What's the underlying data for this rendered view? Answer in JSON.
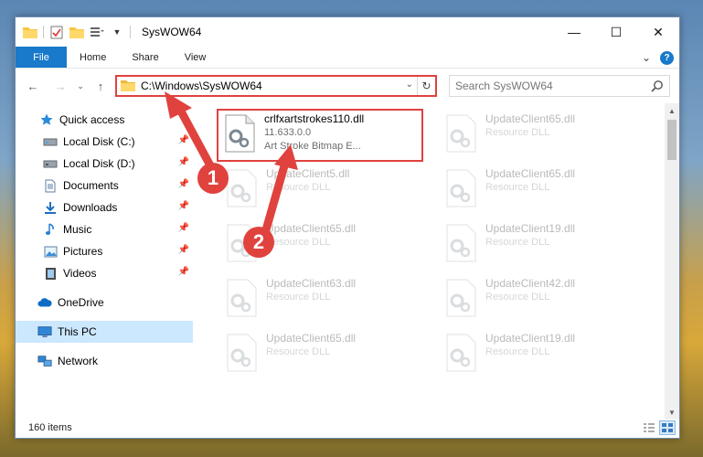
{
  "window": {
    "title": "SysWOW64",
    "controls": {
      "minimize": "—",
      "maximize": "☐",
      "close": "✕"
    }
  },
  "ribbon": {
    "tabs": [
      "File",
      "Home",
      "Share",
      "View"
    ],
    "help": "?",
    "expand": "⌄"
  },
  "nav": {
    "back": "←",
    "forward": "→",
    "recent": "⌄",
    "up": "↑",
    "address": "C:\\Windows\\SysWOW64",
    "dropdown": "⌄",
    "refresh": "↻",
    "search_placeholder": "Search SysWOW64"
  },
  "sidebar": {
    "items": [
      {
        "label": "Quick access",
        "icon": "star-icon",
        "pinned": false
      },
      {
        "label": "Local Disk (C:)",
        "icon": "drive-icon",
        "pinned": true
      },
      {
        "label": "Local Disk (D:)",
        "icon": "drive-icon",
        "pinned": true
      },
      {
        "label": "Documents",
        "icon": "document-icon",
        "pinned": true
      },
      {
        "label": "Downloads",
        "icon": "download-icon",
        "pinned": true
      },
      {
        "label": "Music",
        "icon": "music-icon",
        "pinned": true
      },
      {
        "label": "Pictures",
        "icon": "pictures-icon",
        "pinned": true
      },
      {
        "label": "Videos",
        "icon": "videos-icon",
        "pinned": true
      },
      {
        "label": "OneDrive",
        "icon": "cloud-icon",
        "pinned": false
      },
      {
        "label": "This PC",
        "icon": "computer-icon",
        "pinned": false,
        "selected": true
      },
      {
        "label": "Network",
        "icon": "network-icon",
        "pinned": false
      }
    ]
  },
  "files": [
    {
      "name": "crlfxartstrokes110.dll",
      "line2": "11.633.0.0",
      "line3": "Art Stroke Bitmap E...",
      "highlighted": true
    },
    {
      "name": "UpdateClient65.dll",
      "line2": "Resource DLL",
      "highlighted": false
    },
    {
      "name": "UpdateClient5.dll",
      "line2": "Resource DLL",
      "highlighted": false
    },
    {
      "name": "UpdateClient65.dll",
      "line2": "Resource DLL",
      "highlighted": false
    },
    {
      "name": "UpdateClient65.dll",
      "line2": "Resource DLL",
      "highlighted": false
    },
    {
      "name": "UpdateClient19.dll",
      "line2": "Resource DLL",
      "highlighted": false
    },
    {
      "name": "UpdateClient63.dll",
      "line2": "Resource DLL",
      "highlighted": false
    },
    {
      "name": "UpdateClient42.dll",
      "line2": "Resource DLL",
      "highlighted": false
    },
    {
      "name": "UpdateClient65.dll",
      "line2": "Resource DLL",
      "highlighted": false
    },
    {
      "name": "UpdateClient19.dll",
      "line2": "Resource DLL",
      "highlighted": false
    }
  ],
  "status": {
    "item_count": "160 items"
  },
  "annotations": [
    {
      "label": "1"
    },
    {
      "label": "2"
    }
  ],
  "colors": {
    "accent": "#1979ca",
    "annotation": "#e0423e",
    "selection": "#cce8ff"
  }
}
